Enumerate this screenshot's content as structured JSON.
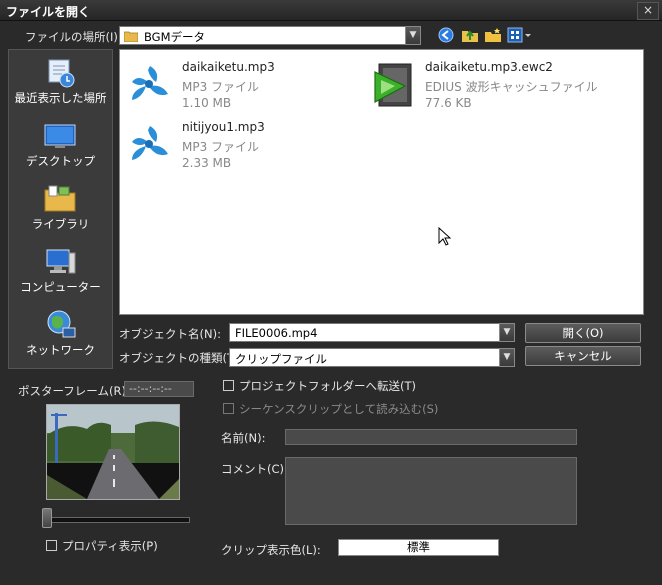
{
  "window": {
    "title": "ファイルを開く",
    "close_label": "×"
  },
  "location": {
    "label": "ファイルの場所(I):",
    "value": "BGMデータ"
  },
  "toolbar": {
    "icons": [
      "back-icon",
      "up-folder-icon",
      "new-folder-icon",
      "view-menu-icon"
    ]
  },
  "places": [
    {
      "label": "最近表示した場所",
      "icon": "recent-places-icon"
    },
    {
      "label": "デスクトップ",
      "icon": "desktop-icon"
    },
    {
      "label": "ライブラリ",
      "icon": "libraries-icon"
    },
    {
      "label": "コンピューター",
      "icon": "computer-icon"
    },
    {
      "label": "ネットワーク",
      "icon": "network-icon"
    }
  ],
  "files": [
    {
      "name": "daikaiketu.mp3",
      "type": "MP3 ファイル",
      "size": "1.10 MB",
      "icon": "mp3-file-icon"
    },
    {
      "name": "daikaiketu.mp3.ewc2",
      "type": "EDIUS 波形キャッシュファイル",
      "size": "77.6 KB",
      "icon": "edius-cache-file-icon"
    },
    {
      "name": "nitijyou1.mp3",
      "type": "MP3 ファイル",
      "size": "2.33 MB",
      "icon": "mp3-file-icon"
    }
  ],
  "object_name": {
    "label": "オブジェクト名(N):",
    "value": "FILE0006.mp4"
  },
  "object_type": {
    "label": "オブジェクトの種類(T):",
    "value": "クリップファイル"
  },
  "buttons": {
    "open": "開く(O)",
    "cancel": "キャンセル",
    "standard": "標準"
  },
  "poster_frame": {
    "label": "ポスターフレーム(R):",
    "value": "--:--:--:--"
  },
  "checkboxes": {
    "project_folder": "プロジェクトフォルダーへ転送(T)",
    "sequence_clip": "シーケンスクリップとして読み込む(S)",
    "properties": "プロパティ表示(P)"
  },
  "fields": {
    "name_label": "名前(N):",
    "comment_label": "コメント(C):",
    "clip_color_label": "クリップ表示色(L):"
  }
}
